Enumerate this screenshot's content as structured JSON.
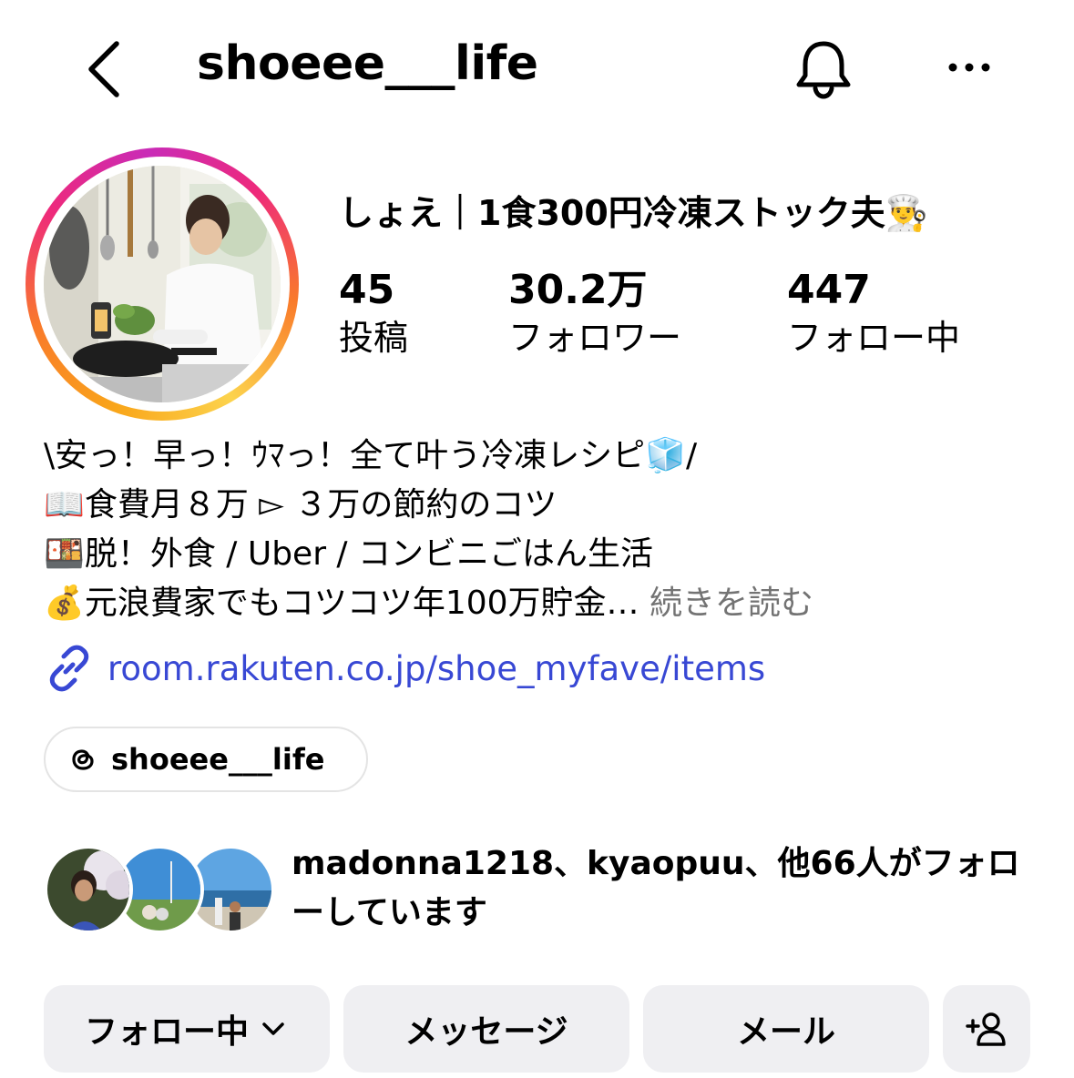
{
  "header": {
    "username": "shoeee___life",
    "back_icon": "chevron-left-icon",
    "bell_icon": "bell-icon",
    "more_icon": "ellipsis-icon"
  },
  "profile": {
    "display_name": "しょえ｜1食300円冷凍ストック夫👨‍🍳",
    "stats": [
      {
        "value": "45",
        "label": "投稿"
      },
      {
        "value": "30.2万",
        "label": "フォロワー"
      },
      {
        "value": "447",
        "label": "フォロー中"
      }
    ]
  },
  "bio": {
    "lines": [
      "\\安っ！早っ！ｳﾏっ！全て叶う冷凍レシピ🧊/",
      "📖食費月８万 ▻ ３万の節約のコツ",
      "🍱脱！外食 / Uber / コンビニごはん生活",
      "💰元浪費家でもコツコツ年100万貯金…"
    ],
    "more_label": "続きを読む",
    "link": "room.rakuten.co.jp/shoe_myfave/items",
    "threads_handle": "shoeee___life"
  },
  "followed_by": {
    "text": "madonna1218、kyaopuu、他66人がフォローしています"
  },
  "actions": {
    "following": "フォロー中",
    "message": "メッセージ",
    "email": "メール",
    "add_user_icon": "add-person-icon"
  },
  "colors": {
    "link": "#3848d4",
    "button_bg": "#efeff2",
    "muted": "#737373"
  }
}
